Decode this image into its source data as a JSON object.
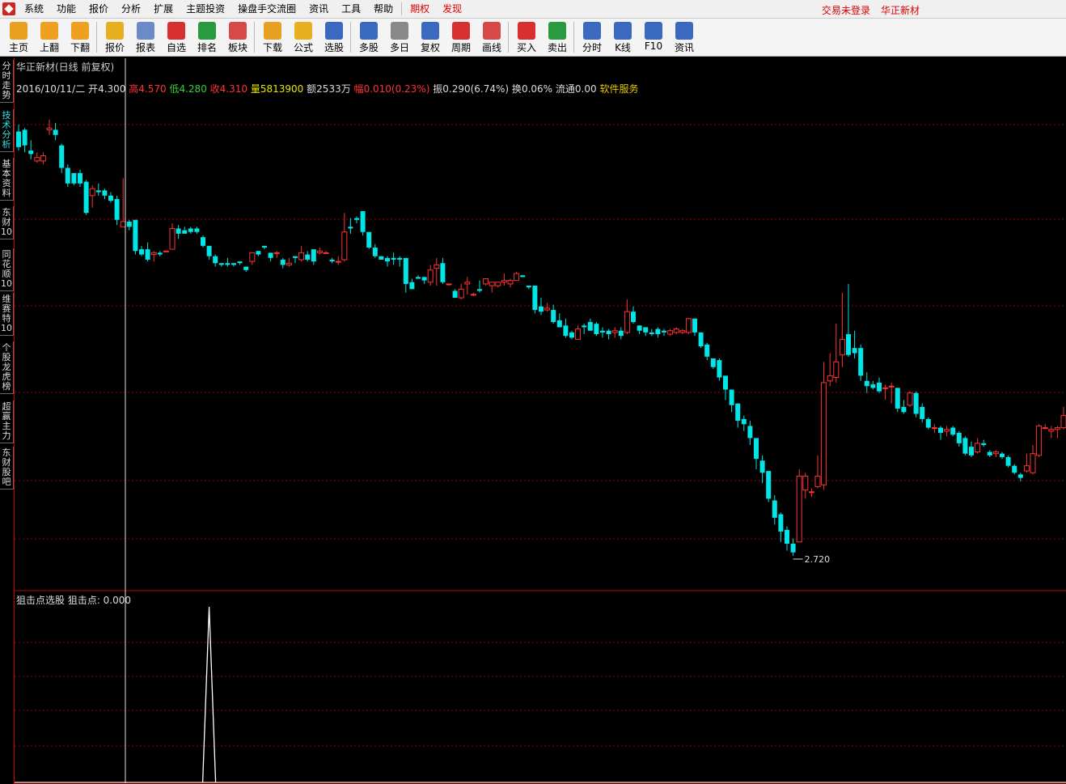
{
  "menubar": {
    "items": [
      "系统",
      "功能",
      "报价",
      "分析",
      "扩展",
      "主题投资",
      "操盘手交流圈",
      "资讯",
      "工具",
      "帮助",
      "期权",
      "发现"
    ],
    "login_status": "交易未登录",
    "stock_name": "华正新材"
  },
  "toolbar": {
    "groups": [
      [
        {
          "label": "主页",
          "icon": "home-icon"
        },
        {
          "label": "上翻",
          "icon": "up-arrow-icon"
        },
        {
          "label": "下翻",
          "icon": "down-arrow-icon"
        }
      ],
      [
        {
          "label": "报价",
          "icon": "yen-icon"
        },
        {
          "label": "报表",
          "icon": "report-icon"
        },
        {
          "label": "自选",
          "icon": "f6-icon"
        },
        {
          "label": "排名",
          "icon": "rank-icon"
        },
        {
          "label": "板块",
          "icon": "sector-icon"
        }
      ],
      [
        {
          "label": "下载",
          "icon": "download-icon"
        },
        {
          "label": "公式",
          "icon": "formula-icon"
        },
        {
          "label": "选股",
          "icon": "select-stock-icon"
        }
      ],
      [
        {
          "label": "多股",
          "icon": "multi-stock-icon"
        },
        {
          "label": "多日",
          "icon": "multi-day-icon"
        },
        {
          "label": "复权",
          "icon": "restore-right-icon"
        },
        {
          "label": "周期",
          "icon": "f8-icon"
        },
        {
          "label": "画线",
          "icon": "draw-line-icon"
        }
      ],
      [
        {
          "label": "买入",
          "icon": "buy-icon"
        },
        {
          "label": "卖出",
          "icon": "sell-icon"
        }
      ],
      [
        {
          "label": "分时",
          "icon": "intraday-icon"
        },
        {
          "label": "K线",
          "icon": "kline-icon"
        },
        {
          "label": "F10",
          "icon": "f10-icon"
        },
        {
          "label": "资讯",
          "icon": "news-icon"
        }
      ]
    ]
  },
  "side_tabs": [
    "分时走势",
    "技术分析",
    "基本资料",
    "东财10",
    "同花顺10",
    "维赛特10",
    "个股龙虎榜",
    "超赢主力",
    "东财股吧"
  ],
  "chart": {
    "title": "华正新材(日线 前复权)",
    "info": {
      "date": "2016/10/11/二",
      "open_label": "开",
      "open": "4.300",
      "high_label": "高",
      "high": "4.570",
      "low_label": "低",
      "low": "4.280",
      "close_label": "收",
      "close": "4.310",
      "volume_label": "量",
      "volume": "5813900",
      "amount_label": "额",
      "amount": "2533万",
      "change_label": "幅",
      "change": "0.010(0.23%)",
      "amplitude_label": "振",
      "amplitude": "0.290(6.74%)",
      "turnover_label": "换",
      "turnover": "0.06%",
      "float_label": "流通",
      "float": "0.00",
      "service": "软件服务"
    },
    "min_price_label": "2.720",
    "indicator_header": "狙击点选股 狙击点: 0.000",
    "colors": {
      "up": "#ff3232",
      "down": "#00e5e5",
      "grid": "#a00000",
      "signal": "#ffffff"
    }
  },
  "chart_data": {
    "type": "candlestick",
    "title": "华正新材(日线 前复权)",
    "min_price": 2.72,
    "candles": [
      {
        "o": 5.17,
        "c": 5.08,
        "h": 5.21,
        "l": 5.06
      },
      {
        "o": 5.18,
        "c": 5.09,
        "h": 5.19,
        "l": 5.05
      },
      {
        "o": 5.06,
        "c": 5.04,
        "h": 5.12,
        "l": 5.01
      },
      {
        "o": 5.0,
        "c": 5.02,
        "h": 5.05,
        "l": 4.99
      },
      {
        "o": 5.0,
        "c": 5.03,
        "h": 5.05,
        "l": 4.98
      },
      {
        "o": 5.18,
        "c": 5.19,
        "h": 5.24,
        "l": 5.15
      },
      {
        "o": 5.18,
        "c": 5.15,
        "h": 5.22,
        "l": 5.12
      },
      {
        "o": 5.09,
        "c": 4.96,
        "h": 5.1,
        "l": 4.93
      },
      {
        "o": 4.96,
        "c": 4.87,
        "h": 4.98,
        "l": 4.85
      },
      {
        "o": 4.93,
        "c": 4.87,
        "h": 4.93,
        "l": 4.86
      },
      {
        "o": 4.93,
        "c": 4.87,
        "h": 4.95,
        "l": 4.85
      },
      {
        "o": 4.88,
        "c": 4.7,
        "h": 4.89,
        "l": 4.69
      },
      {
        "o": 4.8,
        "c": 4.84,
        "h": 4.86,
        "l": 4.73
      },
      {
        "o": 4.83,
        "c": 4.82,
        "h": 4.87,
        "l": 4.8
      },
      {
        "o": 4.83,
        "c": 4.8,
        "h": 4.84,
        "l": 4.78
      },
      {
        "o": 4.8,
        "c": 4.77,
        "h": 4.82,
        "l": 4.76
      },
      {
        "o": 4.78,
        "c": 4.66,
        "h": 4.8,
        "l": 4.63
      },
      {
        "o": 4.62,
        "c": 4.65,
        "h": 4.9,
        "l": 4.62
      },
      {
        "o": 4.65,
        "c": 4.62,
        "h": 4.66,
        "l": 4.6
      },
      {
        "o": 4.66,
        "c": 4.48,
        "h": 4.66,
        "l": 4.46
      },
      {
        "o": 4.49,
        "c": 4.46,
        "h": 4.51,
        "l": 4.45
      },
      {
        "o": 4.49,
        "c": 4.43,
        "h": 4.53,
        "l": 4.42
      },
      {
        "o": 4.46,
        "c": 4.47,
        "h": 4.48,
        "l": 4.42
      },
      {
        "o": 4.47,
        "c": 4.46,
        "h": 4.48,
        "l": 4.45
      },
      {
        "o": 4.48,
        "c": 4.48,
        "h": 4.48,
        "l": 4.48
      },
      {
        "o": 4.49,
        "c": 4.61,
        "h": 4.64,
        "l": 4.49
      },
      {
        "o": 4.61,
        "c": 4.58,
        "h": 4.63,
        "l": 4.55
      },
      {
        "o": 4.6,
        "c": 4.58,
        "h": 4.62,
        "l": 4.58
      },
      {
        "o": 4.61,
        "c": 4.59,
        "h": 4.62,
        "l": 4.58
      },
      {
        "o": 4.61,
        "c": 4.59,
        "h": 4.62,
        "l": 4.58
      },
      {
        "o": 4.56,
        "c": 4.51,
        "h": 4.57,
        "l": 4.5
      },
      {
        "o": 4.51,
        "c": 4.45,
        "h": 4.51,
        "l": 4.43
      },
      {
        "o": 4.45,
        "c": 4.41,
        "h": 4.46,
        "l": 4.39
      },
      {
        "o": 4.41,
        "c": 4.4,
        "h": 4.41,
        "l": 4.39
      },
      {
        "o": 4.41,
        "c": 4.4,
        "h": 4.44,
        "l": 4.39
      },
      {
        "o": 4.41,
        "c": 4.4,
        "h": 4.41,
        "l": 4.39
      },
      {
        "o": 4.42,
        "c": 4.41,
        "h": 4.42,
        "l": 4.4
      },
      {
        "o": 4.39,
        "c": 4.37,
        "h": 4.39,
        "l": 4.36
      },
      {
        "o": 4.42,
        "c": 4.47,
        "h": 4.47,
        "l": 4.4
      },
      {
        "o": 4.48,
        "c": 4.46,
        "h": 4.48,
        "l": 4.45
      },
      {
        "o": 4.51,
        "c": 4.5,
        "h": 4.51,
        "l": 4.49
      },
      {
        "o": 4.47,
        "c": 4.44,
        "h": 4.47,
        "l": 4.42
      },
      {
        "o": 4.47,
        "c": 4.47,
        "h": 4.48,
        "l": 4.44
      },
      {
        "o": 4.43,
        "c": 4.4,
        "h": 4.44,
        "l": 4.38
      },
      {
        "o": 4.4,
        "c": 4.41,
        "h": 4.44,
        "l": 4.39
      },
      {
        "o": 4.45,
        "c": 4.44,
        "h": 4.45,
        "l": 4.41
      },
      {
        "o": 4.43,
        "c": 4.47,
        "h": 4.51,
        "l": 4.42
      },
      {
        "o": 4.46,
        "c": 4.43,
        "h": 4.48,
        "l": 4.42
      },
      {
        "o": 4.49,
        "c": 4.42,
        "h": 4.49,
        "l": 4.4
      },
      {
        "o": 4.47,
        "c": 4.48,
        "h": 4.5,
        "l": 4.46
      },
      {
        "o": 4.47,
        "c": 4.47,
        "h": 4.48,
        "l": 4.47
      },
      {
        "o": 4.43,
        "c": 4.42,
        "h": 4.44,
        "l": 4.41
      },
      {
        "o": 4.42,
        "c": 4.42,
        "h": 4.45,
        "l": 4.4
      },
      {
        "o": 4.43,
        "c": 4.59,
        "h": 4.7,
        "l": 4.42
      },
      {
        "o": 4.62,
        "c": 4.61,
        "h": 4.67,
        "l": 4.58
      },
      {
        "o": 4.67,
        "c": 4.66,
        "h": 4.68,
        "l": 4.64
      },
      {
        "o": 4.71,
        "c": 4.59,
        "h": 4.71,
        "l": 4.57
      },
      {
        "o": 4.59,
        "c": 4.5,
        "h": 4.59,
        "l": 4.49
      },
      {
        "o": 4.5,
        "c": 4.45,
        "h": 4.52,
        "l": 4.44
      },
      {
        "o": 4.45,
        "c": 4.43,
        "h": 4.45,
        "l": 4.43
      },
      {
        "o": 4.44,
        "c": 4.42,
        "h": 4.45,
        "l": 4.39
      },
      {
        "o": 4.44,
        "c": 4.43,
        "h": 4.47,
        "l": 4.4
      },
      {
        "o": 4.44,
        "c": 4.43,
        "h": 4.45,
        "l": 4.39
      },
      {
        "o": 4.44,
        "c": 4.29,
        "h": 4.44,
        "l": 4.24
      },
      {
        "o": 4.3,
        "c": 4.26,
        "h": 4.32,
        "l": 4.26
      },
      {
        "o": 4.33,
        "c": 4.32,
        "h": 4.34,
        "l": 4.32
      },
      {
        "o": 4.33,
        "c": 4.31,
        "h": 4.33,
        "l": 4.29
      },
      {
        "o": 4.3,
        "c": 4.37,
        "h": 4.4,
        "l": 4.28
      },
      {
        "o": 4.38,
        "c": 4.4,
        "h": 4.44,
        "l": 4.28
      },
      {
        "o": 4.41,
        "c": 4.3,
        "h": 4.44,
        "l": 4.29
      },
      {
        "o": 4.29,
        "c": 4.29,
        "h": 4.29,
        "l": 4.28
      },
      {
        "o": 4.25,
        "c": 4.21,
        "h": 4.26,
        "l": 4.21
      },
      {
        "o": 4.21,
        "c": 4.26,
        "h": 4.29,
        "l": 4.2
      },
      {
        "o": 4.29,
        "c": 4.3,
        "h": 4.33,
        "l": 4.23
      },
      {
        "o": 4.23,
        "c": 4.23,
        "h": 4.24,
        "l": 4.22
      },
      {
        "o": 4.26,
        "c": 4.25,
        "h": 4.31,
        "l": 4.24
      },
      {
        "o": 4.29,
        "c": 4.32,
        "h": 4.32,
        "l": 4.28
      },
      {
        "o": 4.28,
        "c": 4.3,
        "h": 4.3,
        "l": 4.24
      },
      {
        "o": 4.28,
        "c": 4.3,
        "h": 4.3,
        "l": 4.27
      },
      {
        "o": 4.3,
        "c": 4.31,
        "h": 4.35,
        "l": 4.28
      },
      {
        "o": 4.29,
        "c": 4.31,
        "h": 4.32,
        "l": 4.27
      },
      {
        "o": 4.31,
        "c": 4.35,
        "h": 4.36,
        "l": 4.31
      },
      {
        "o": 4.34,
        "c": 4.33,
        "h": 4.34,
        "l": 4.33
      },
      {
        "o": 4.28,
        "c": 4.27,
        "h": 4.28,
        "l": 4.26
      },
      {
        "o": 4.28,
        "c": 4.14,
        "h": 4.28,
        "l": 4.12
      },
      {
        "o": 4.16,
        "c": 4.13,
        "h": 4.21,
        "l": 4.11
      },
      {
        "o": 4.14,
        "c": 4.15,
        "h": 4.18,
        "l": 4.13
      },
      {
        "o": 4.14,
        "c": 4.07,
        "h": 4.17,
        "l": 4.06
      },
      {
        "o": 4.08,
        "c": 4.04,
        "h": 4.12,
        "l": 4.04
      },
      {
        "o": 4.05,
        "c": 3.99,
        "h": 4.09,
        "l": 3.98
      },
      {
        "o": 4.01,
        "c": 3.98,
        "h": 4.02,
        "l": 3.97
      },
      {
        "o": 3.97,
        "c": 4.03,
        "h": 4.05,
        "l": 3.97
      },
      {
        "o": 4.05,
        "c": 4.04,
        "h": 4.06,
        "l": 4.0
      },
      {
        "o": 4.07,
        "c": 4.02,
        "h": 4.09,
        "l": 4.02
      },
      {
        "o": 4.06,
        "c": 4.0,
        "h": 4.07,
        "l": 3.99
      },
      {
        "o": 4.02,
        "c": 4.01,
        "h": 4.04,
        "l": 3.98
      },
      {
        "o": 4.02,
        "c": 4.0,
        "h": 4.03,
        "l": 3.97
      },
      {
        "o": 4.01,
        "c": 4.02,
        "h": 4.04,
        "l": 3.98
      },
      {
        "o": 4.02,
        "c": 3.99,
        "h": 4.04,
        "l": 3.97
      },
      {
        "o": 4.01,
        "c": 4.13,
        "h": 4.2,
        "l": 4.0
      },
      {
        "o": 4.13,
        "c": 4.07,
        "h": 4.16,
        "l": 4.06
      },
      {
        "o": 4.05,
        "c": 4.02,
        "h": 4.05,
        "l": 4.0
      },
      {
        "o": 4.04,
        "c": 4.01,
        "h": 4.04,
        "l": 3.99
      },
      {
        "o": 4.01,
        "c": 4.0,
        "h": 4.03,
        "l": 3.99
      },
      {
        "o": 4.03,
        "c": 4.0,
        "h": 4.04,
        "l": 3.98
      },
      {
        "o": 4.02,
        "c": 4.01,
        "h": 4.03,
        "l": 3.99
      },
      {
        "o": 4.0,
        "c": 4.02,
        "h": 4.03,
        "l": 3.99
      },
      {
        "o": 4.01,
        "c": 4.03,
        "h": 4.04,
        "l": 4.0
      },
      {
        "o": 4.01,
        "c": 4.02,
        "h": 4.03,
        "l": 4.0
      },
      {
        "o": 4.01,
        "c": 4.09,
        "h": 4.09,
        "l": 4.0
      },
      {
        "o": 4.09,
        "c": 4.01,
        "h": 4.09,
        "l": 3.99
      },
      {
        "o": 4.01,
        "c": 3.93,
        "h": 4.01,
        "l": 3.92
      },
      {
        "o": 3.94,
        "c": 3.87,
        "h": 3.95,
        "l": 3.85
      },
      {
        "o": 3.86,
        "c": 3.81,
        "h": 3.86,
        "l": 3.8
      },
      {
        "o": 3.85,
        "c": 3.75,
        "h": 3.86,
        "l": 3.73
      },
      {
        "o": 3.76,
        "c": 3.68,
        "h": 3.76,
        "l": 3.62
      },
      {
        "o": 3.68,
        "c": 3.59,
        "h": 3.68,
        "l": 3.55
      },
      {
        "o": 3.6,
        "c": 3.5,
        "h": 3.6,
        "l": 3.46
      },
      {
        "o": 3.51,
        "c": 3.48,
        "h": 3.53,
        "l": 3.44
      },
      {
        "o": 3.47,
        "c": 3.4,
        "h": 3.5,
        "l": 3.36
      },
      {
        "o": 3.4,
        "c": 3.28,
        "h": 3.4,
        "l": 3.22
      },
      {
        "o": 3.27,
        "c": 3.2,
        "h": 3.3,
        "l": 3.14
      },
      {
        "o": 3.21,
        "c": 3.05,
        "h": 3.21,
        "l": 3.03
      },
      {
        "o": 3.04,
        "c": 2.94,
        "h": 3.07,
        "l": 2.9
      },
      {
        "o": 2.96,
        "c": 2.86,
        "h": 2.97,
        "l": 2.8
      },
      {
        "o": 2.87,
        "c": 2.79,
        "h": 2.89,
        "l": 2.75
      },
      {
        "o": 2.79,
        "c": 2.74,
        "h": 2.82,
        "l": 2.72
      },
      {
        "o": 2.8,
        "c": 3.18,
        "h": 3.22,
        "l": 2.8
      },
      {
        "o": 3.1,
        "c": 3.18,
        "h": 3.2,
        "l": 3.05
      },
      {
        "o": 3.09,
        "c": 3.09,
        "h": 3.11,
        "l": 3.06
      },
      {
        "o": 3.12,
        "c": 3.18,
        "h": 3.3,
        "l": 3.11
      },
      {
        "o": 3.13,
        "c": 3.72,
        "h": 3.84,
        "l": 3.1
      },
      {
        "o": 3.73,
        "c": 3.76,
        "h": 3.89,
        "l": 3.7
      },
      {
        "o": 3.75,
        "c": 3.84,
        "h": 4.06,
        "l": 3.72
      },
      {
        "o": 3.88,
        "c": 3.97,
        "h": 4.24,
        "l": 3.81
      },
      {
        "o": 4.0,
        "c": 3.88,
        "h": 4.29,
        "l": 3.87
      },
      {
        "o": 3.92,
        "c": 3.89,
        "h": 4.02,
        "l": 3.86
      },
      {
        "o": 3.92,
        "c": 3.76,
        "h": 3.94,
        "l": 3.73
      },
      {
        "o": 3.73,
        "c": 3.7,
        "h": 3.78,
        "l": 3.66
      },
      {
        "o": 3.71,
        "c": 3.69,
        "h": 3.73,
        "l": 3.68
      },
      {
        "o": 3.72,
        "c": 3.67,
        "h": 3.75,
        "l": 3.66
      },
      {
        "o": 3.69,
        "c": 3.69,
        "h": 3.71,
        "l": 3.62
      },
      {
        "o": 3.7,
        "c": 3.7,
        "h": 3.72,
        "l": 3.6
      },
      {
        "o": 3.69,
        "c": 3.57,
        "h": 3.69,
        "l": 3.55
      },
      {
        "o": 3.58,
        "c": 3.55,
        "h": 3.62,
        "l": 3.54
      },
      {
        "o": 3.59,
        "c": 3.66,
        "h": 3.67,
        "l": 3.58
      },
      {
        "o": 3.66,
        "c": 3.54,
        "h": 3.67,
        "l": 3.52
      },
      {
        "o": 3.58,
        "c": 3.51,
        "h": 3.6,
        "l": 3.49
      },
      {
        "o": 3.51,
        "c": 3.46,
        "h": 3.52,
        "l": 3.45
      },
      {
        "o": 3.46,
        "c": 3.46,
        "h": 3.48,
        "l": 3.43
      },
      {
        "o": 3.46,
        "c": 3.43,
        "h": 3.47,
        "l": 3.39
      },
      {
        "o": 3.44,
        "c": 3.45,
        "h": 3.47,
        "l": 3.41
      },
      {
        "o": 3.46,
        "c": 3.42,
        "h": 3.47,
        "l": 3.41
      },
      {
        "o": 3.43,
        "c": 3.37,
        "h": 3.44,
        "l": 3.35
      },
      {
        "o": 3.4,
        "c": 3.31,
        "h": 3.41,
        "l": 3.3
      },
      {
        "o": 3.35,
        "c": 3.3,
        "h": 3.38,
        "l": 3.29
      },
      {
        "o": 3.32,
        "c": 3.37,
        "h": 3.4,
        "l": 3.31
      },
      {
        "o": 3.37,
        "c": 3.36,
        "h": 3.39,
        "l": 3.35
      },
      {
        "o": 3.32,
        "c": 3.3,
        "h": 3.33,
        "l": 3.29
      },
      {
        "o": 3.31,
        "c": 3.32,
        "h": 3.33,
        "l": 3.29
      },
      {
        "o": 3.31,
        "c": 3.29,
        "h": 3.32,
        "l": 3.28
      },
      {
        "o": 3.29,
        "c": 3.24,
        "h": 3.3,
        "l": 3.23
      },
      {
        "o": 3.24,
        "c": 3.2,
        "h": 3.25,
        "l": 3.19
      },
      {
        "o": 3.19,
        "c": 3.17,
        "h": 3.2,
        "l": 3.15
      },
      {
        "o": 3.21,
        "c": 3.24,
        "h": 3.31,
        "l": 3.2
      },
      {
        "o": 3.2,
        "c": 3.31,
        "h": 3.36,
        "l": 3.19
      },
      {
        "o": 3.3,
        "c": 3.47,
        "h": 3.48,
        "l": 3.29
      },
      {
        "o": 3.46,
        "c": 3.46,
        "h": 3.48,
        "l": 3.45
      },
      {
        "o": 3.44,
        "c": 3.45,
        "h": 3.47,
        "l": 3.4
      },
      {
        "o": 3.45,
        "c": 3.46,
        "h": 3.47,
        "l": 3.4
      },
      {
        "o": 3.46,
        "c": 3.53,
        "h": 3.58,
        "l": 3.45
      }
    ],
    "indicator": {
      "name": "狙击点选股",
      "signal_candle_index": 31
    }
  }
}
